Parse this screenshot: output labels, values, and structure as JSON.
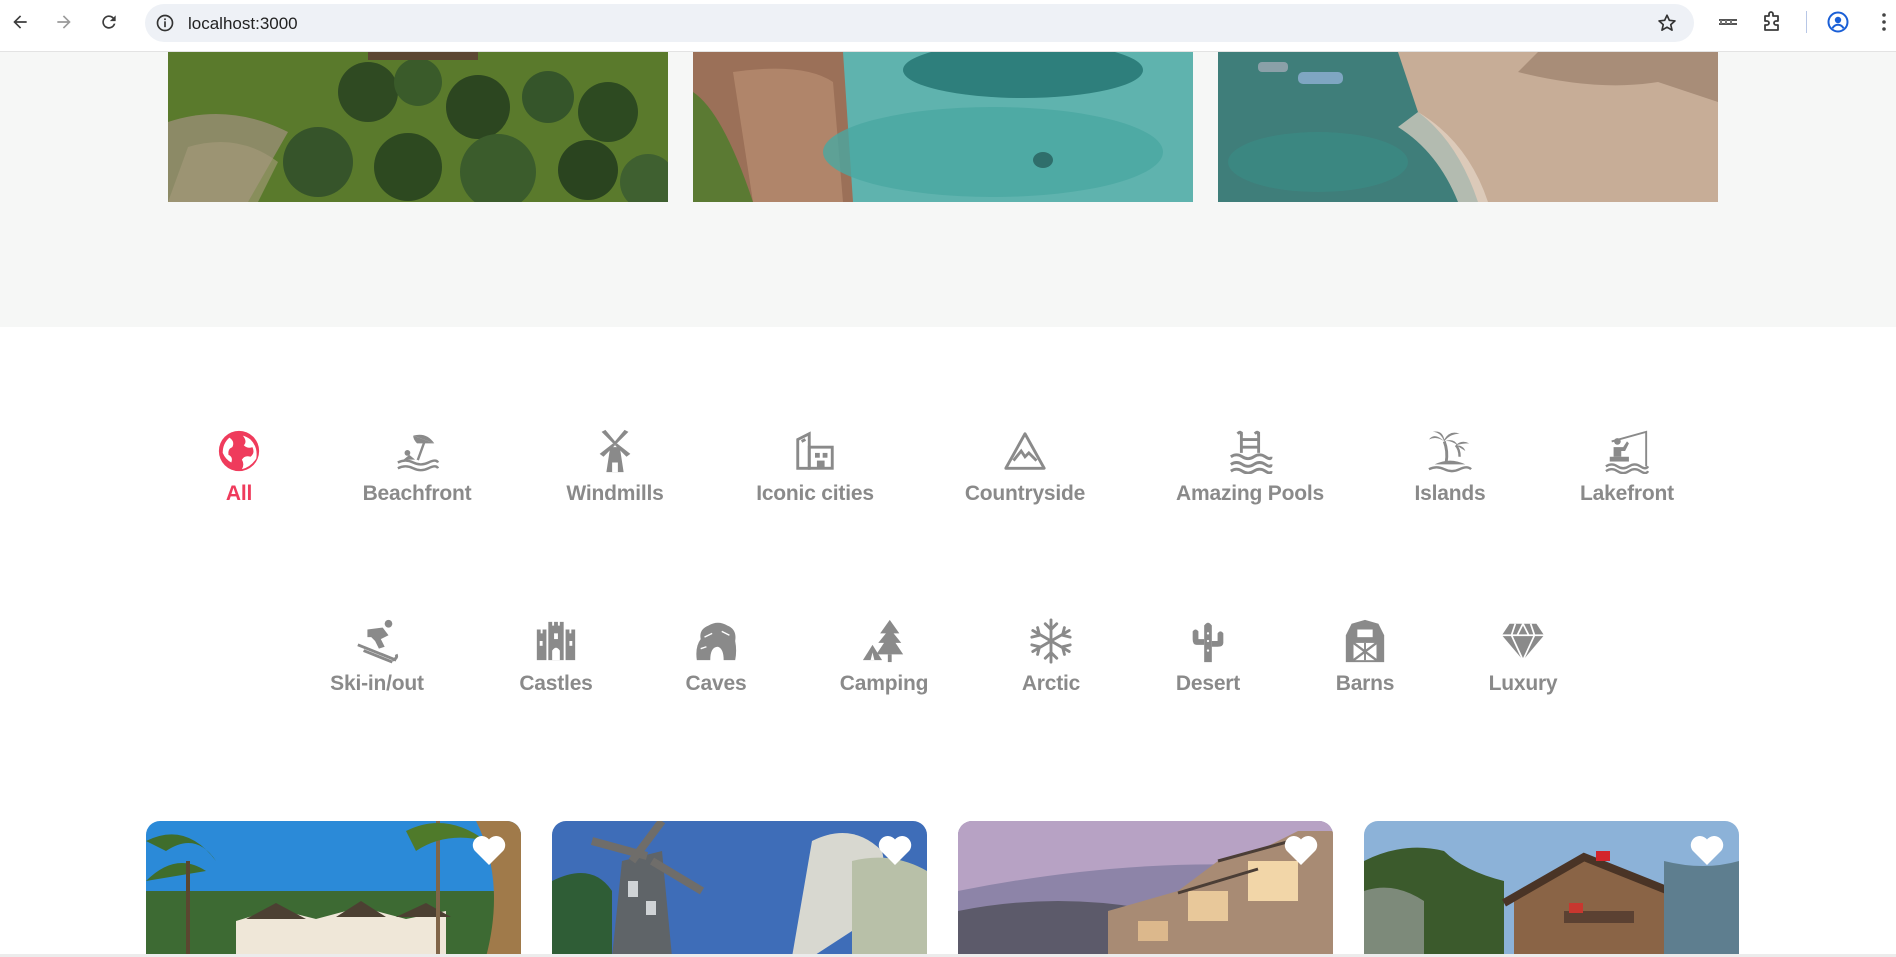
{
  "browser": {
    "url": "localhost:3000",
    "icons": [
      "back-icon",
      "forward-icon",
      "reload-icon",
      "site-info-icon",
      "bookmark-star-icon",
      "extension-bars-icon",
      "puzzle-extensions-icon",
      "profile-icon",
      "kebab-menu-icon"
    ]
  },
  "hero": {
    "images": [
      "countryside-shrubs-photo",
      "pool-photo",
      "beach-boats-photo"
    ]
  },
  "categories": {
    "row1": [
      {
        "label": "All",
        "icon": "globe-icon",
        "active": true
      },
      {
        "label": "Beachfront",
        "icon": "beach-umbrella-icon"
      },
      {
        "label": "Windmills",
        "icon": "windmill-icon"
      },
      {
        "label": "Iconic cities",
        "icon": "city-building-icon"
      },
      {
        "label": "Countryside",
        "icon": "mountain-icon"
      },
      {
        "label": "Amazing Pools",
        "icon": "pool-ladder-icon"
      },
      {
        "label": "Islands",
        "icon": "palm-island-icon"
      },
      {
        "label": "Lakefront",
        "icon": "fishing-icon"
      }
    ],
    "row2": [
      {
        "label": "Ski-in/out",
        "icon": "skier-icon"
      },
      {
        "label": "Castles",
        "icon": "castle-icon"
      },
      {
        "label": "Caves",
        "icon": "cave-icon"
      },
      {
        "label": "Camping",
        "icon": "tent-tree-icon"
      },
      {
        "label": "Arctic",
        "icon": "snowflake-icon"
      },
      {
        "label": "Desert",
        "icon": "cactus-icon"
      },
      {
        "label": "Barns",
        "icon": "barn-icon"
      },
      {
        "label": "Luxury",
        "icon": "diamond-icon"
      }
    ],
    "active_color": "#ef3b5c",
    "inactive_color": "#8a8a8a"
  },
  "listings": [
    {
      "photo": "tropical-villa-photo",
      "favorite_icon": "heart-icon"
    },
    {
      "photo": "windmill-house-photo",
      "favorite_icon": "heart-icon"
    },
    {
      "photo": "modern-lakeside-homes-photo",
      "favorite_icon": "heart-icon"
    },
    {
      "photo": "mountain-chalet-photo",
      "favorite_icon": "heart-icon"
    }
  ]
}
